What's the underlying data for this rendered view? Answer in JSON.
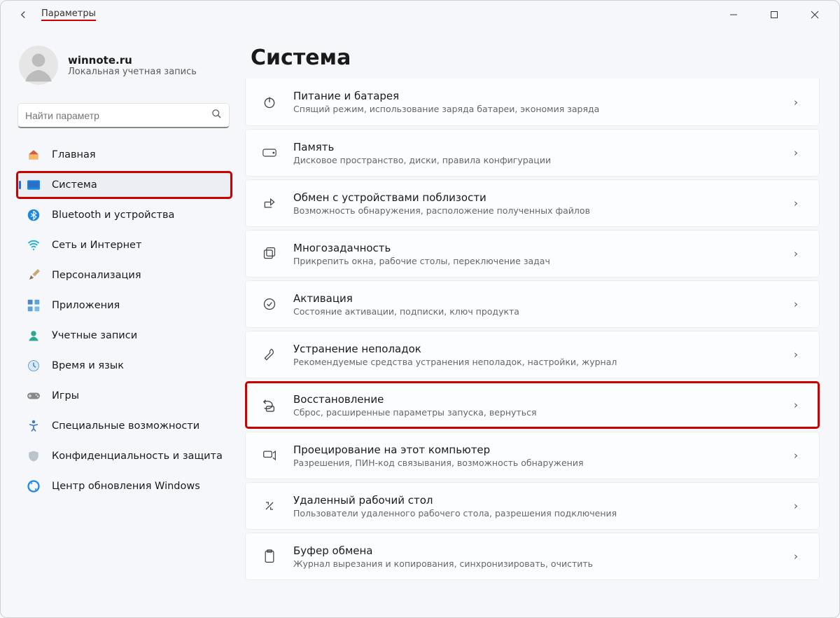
{
  "window": {
    "title": "Параметры"
  },
  "account": {
    "name": "winnote.ru",
    "subtitle": "Локальная учетная запись"
  },
  "search": {
    "placeholder": "Найти параметр"
  },
  "sidebar": {
    "items": [
      {
        "id": "home",
        "label": "Главная"
      },
      {
        "id": "system",
        "label": "Система"
      },
      {
        "id": "bluetooth",
        "label": "Bluetooth и устройства"
      },
      {
        "id": "network",
        "label": "Сеть и Интернет"
      },
      {
        "id": "personalization",
        "label": "Персонализация"
      },
      {
        "id": "apps",
        "label": "Приложения"
      },
      {
        "id": "accounts",
        "label": "Учетные записи"
      },
      {
        "id": "time",
        "label": "Время и язык"
      },
      {
        "id": "gaming",
        "label": "Игры"
      },
      {
        "id": "accessibility",
        "label": "Специальные возможности"
      },
      {
        "id": "privacy",
        "label": "Конфиденциальность и защита"
      },
      {
        "id": "update",
        "label": "Центр обновления Windows"
      }
    ]
  },
  "page": {
    "title": "Система",
    "items": [
      {
        "id": "power",
        "title": "Питание и батарея",
        "sub": "Спящий режим, использование заряда батареи, экономия заряда"
      },
      {
        "id": "storage",
        "title": "Память",
        "sub": "Дисковое пространство, диски, правила конфигурации"
      },
      {
        "id": "nearby",
        "title": "Обмен с устройствами поблизости",
        "sub": "Возможность обнаружения, расположение полученных файлов"
      },
      {
        "id": "multitask",
        "title": "Многозадачность",
        "sub": "Прикрепить окна, рабочие столы, переключение задач"
      },
      {
        "id": "activation",
        "title": "Активация",
        "sub": "Состояние активации, подписки, ключ продукта"
      },
      {
        "id": "troubleshoot",
        "title": "Устранение неполадок",
        "sub": "Рекомендуемые средства устранения неполадок, настройки, журнал"
      },
      {
        "id": "recovery",
        "title": "Восстановление",
        "sub": "Сброс, расширенные параметры запуска, вернуться"
      },
      {
        "id": "project",
        "title": "Проецирование на этот компьютер",
        "sub": "Разрешения, ПИН-код связывания, возможность обнаружения"
      },
      {
        "id": "remote",
        "title": "Удаленный рабочий стол",
        "sub": "Пользователи удаленного рабочего стола, разрешения подключения"
      },
      {
        "id": "clipboard",
        "title": "Буфер обмена",
        "sub": "Журнал вырезания и копирования, синхронизировать, очистить"
      }
    ]
  }
}
